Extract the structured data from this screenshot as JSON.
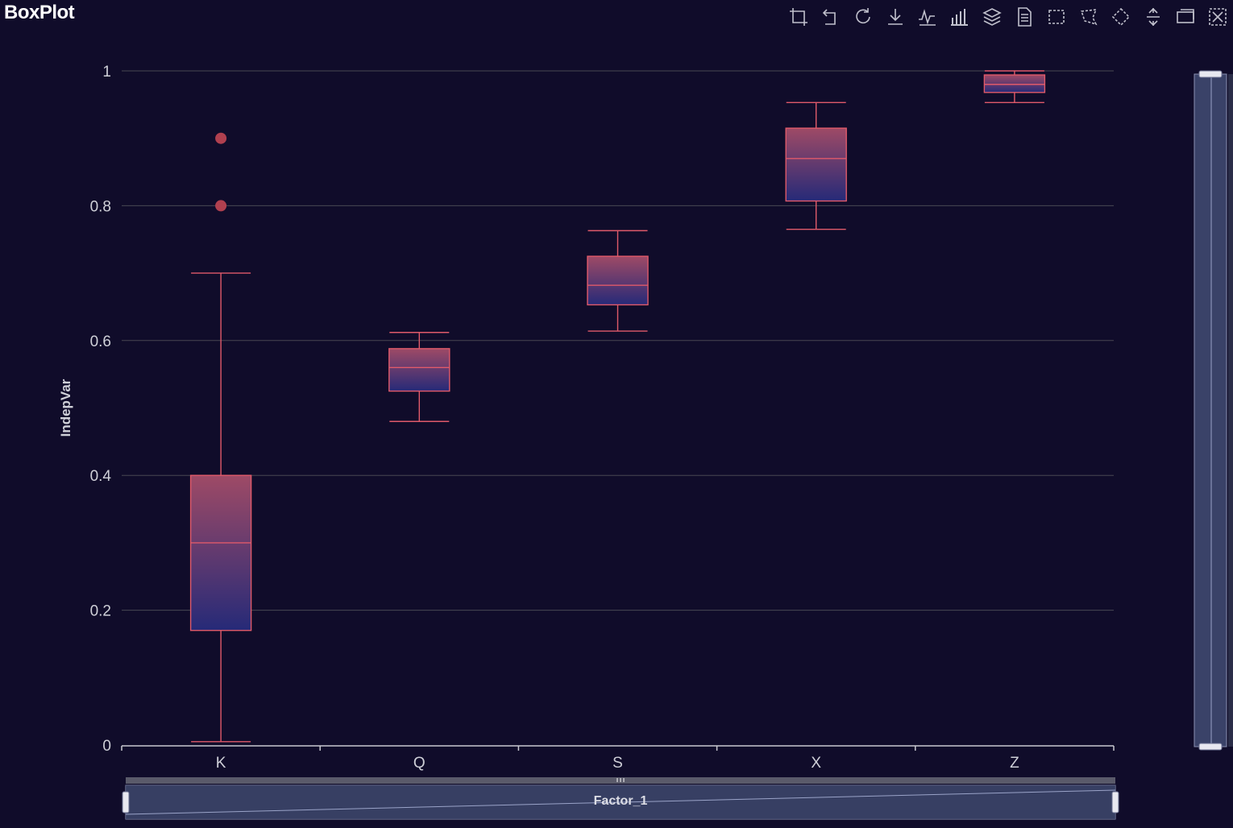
{
  "title": "BoxPlot",
  "colors": {
    "background": "#100c2a",
    "box_stroke": "#e05a6a",
    "box_top": "#9e4a66",
    "box_bottom": "#262a78",
    "outlier": "#b0404f",
    "grid": "#484753",
    "axis": "#c8c8d0"
  },
  "toolbox": [
    {
      "name": "zoom-icon"
    },
    {
      "name": "zoom-back-icon"
    },
    {
      "name": "restore-icon"
    },
    {
      "name": "download-icon"
    },
    {
      "name": "line-chart-icon"
    },
    {
      "name": "bar-chart-icon"
    },
    {
      "name": "stack-icon"
    },
    {
      "name": "data-view-icon"
    },
    {
      "name": "rect-select-icon"
    },
    {
      "name": "lasso-select-icon"
    },
    {
      "name": "keep-select-icon"
    },
    {
      "name": "clear-select-icon"
    },
    {
      "name": "brush-icon"
    },
    {
      "name": "clear-brush-icon"
    }
  ],
  "chart_data": {
    "type": "boxplot",
    "title": "BoxPlot",
    "xlabel": "",
    "ylabel": "IndepVar",
    "categories": [
      "K",
      "Q",
      "S",
      "X",
      "Z"
    ],
    "ylim": [
      0,
      1
    ],
    "yticks": [
      "0",
      "0.2",
      "0.4",
      "0.6",
      "0.8",
      "1"
    ],
    "grid": true,
    "boxes": [
      {
        "category": "K",
        "min": 0.005,
        "q1": 0.17,
        "median": 0.3,
        "q3": 0.4,
        "max": 0.7
      },
      {
        "category": "Q",
        "min": 0.48,
        "q1": 0.525,
        "median": 0.56,
        "q3": 0.588,
        "max": 0.612
      },
      {
        "category": "S",
        "min": 0.614,
        "q1": 0.653,
        "median": 0.682,
        "q3": 0.725,
        "max": 0.763
      },
      {
        "category": "X",
        "min": 0.765,
        "q1": 0.807,
        "median": 0.87,
        "q3": 0.915,
        "max": 0.953
      },
      {
        "category": "Z",
        "min": 0.953,
        "q1": 0.968,
        "median": 0.98,
        "q3": 0.994,
        "max": 1.0
      }
    ],
    "outliers": [
      {
        "category": "K",
        "value": 0.9
      },
      {
        "category": "K",
        "value": 0.8
      }
    ],
    "x_zoom": {
      "label": "Factor_1",
      "start": 0,
      "end": 100
    },
    "y_zoom": {
      "start": 0,
      "end": 100
    }
  }
}
